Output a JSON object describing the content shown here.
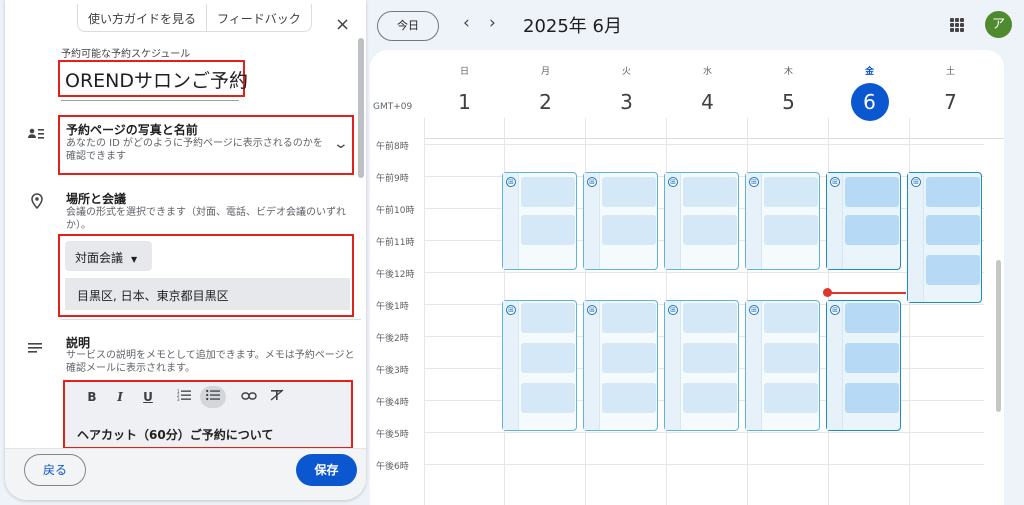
{
  "panel": {
    "guide_label": "使い方ガイドを見る",
    "feedback_label": "フィードバック",
    "close_icon": "×",
    "schedule_label": "予約可能な予約スケジュール",
    "schedule_title": "ORENDサロンご予約",
    "photo_section": {
      "title": "予約ページの写真と名前",
      "desc": "あなたの ID がどのように予約ページに表示されるのかを確認できます"
    },
    "location_section": {
      "title": "場所と会議",
      "desc": "会議の形式を選択できます（対面、電話、ビデオ会議のいずれか）。",
      "mode_value": "対面会議",
      "address_value": "目黒区, 日本、東京都目黒区"
    },
    "description_section": {
      "title": "説明",
      "desc": "サービスの説明をメモとして追加できます。メモは予約ページと確認メールに表示されます。",
      "editor_text": "ヘアカット（60分）ご予約について"
    },
    "back_label": "戻る",
    "save_label": "保存"
  },
  "calendar": {
    "today_label": "今日",
    "month_title": "2025年 6月",
    "avatar_letter": "ア",
    "timezone": "GMT+09",
    "days": [
      {
        "dow": "日",
        "num": "1"
      },
      {
        "dow": "月",
        "num": "2"
      },
      {
        "dow": "火",
        "num": "3"
      },
      {
        "dow": "水",
        "num": "4"
      },
      {
        "dow": "木",
        "num": "5"
      },
      {
        "dow": "金",
        "num": "6",
        "current": true
      },
      {
        "dow": "土",
        "num": "7"
      }
    ],
    "hours": [
      "午前8時",
      "午前9時",
      "午前10時",
      "午前11時",
      "午後12時",
      "午後1時",
      "午後2時",
      "午後3時",
      "午後4時",
      "午後5時",
      "午後6時"
    ],
    "accent_color": "#0b57d0",
    "now_line_color": "#dc362e"
  }
}
